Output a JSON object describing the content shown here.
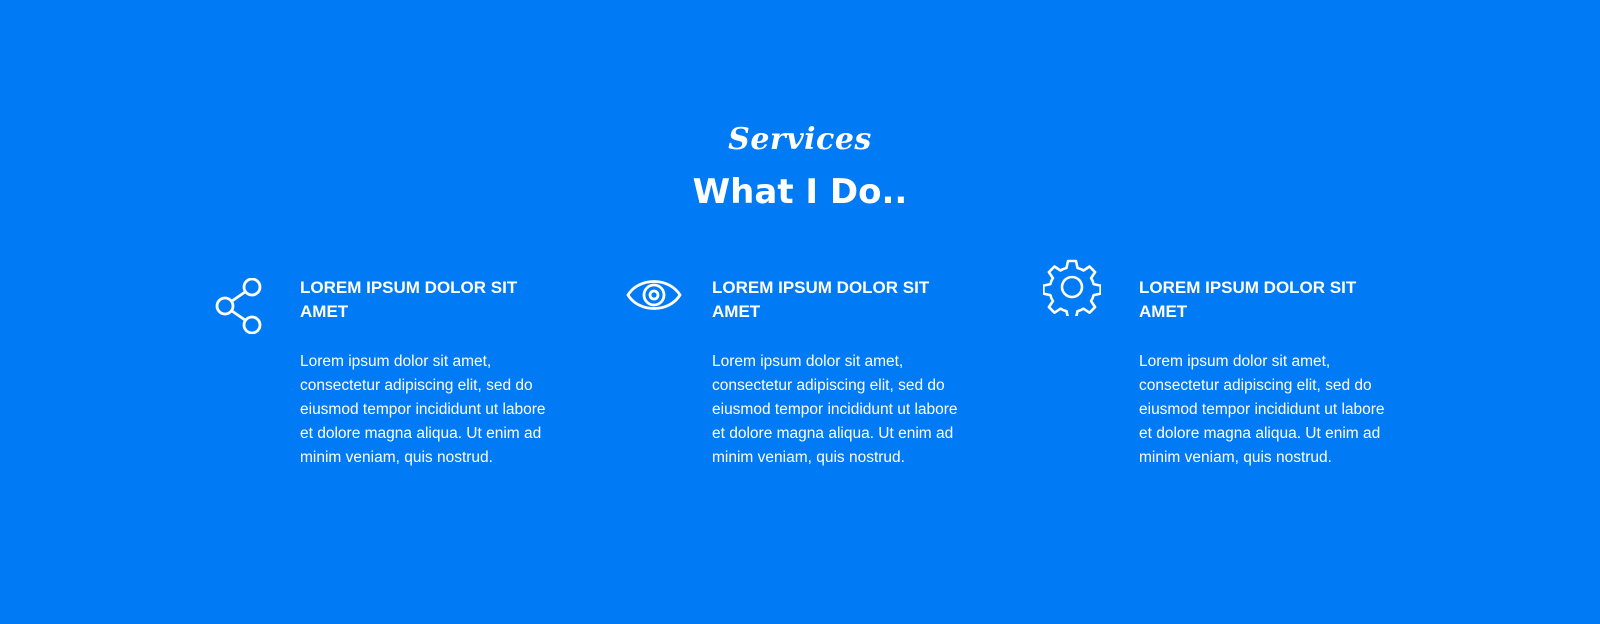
{
  "section": {
    "eyebrow": "Services",
    "title": "What I Do.."
  },
  "services": [
    {
      "icon": "share-icon",
      "title": "LOREM IPSUM DOLOR SIT AMET",
      "text": "Lorem ipsum dolor sit amet, consectetur adipiscing elit, sed do eiusmod tempor incididunt ut labore et dolore magna aliqua. Ut enim ad minim veniam, quis nostrud."
    },
    {
      "icon": "eye-icon",
      "title": "LOREM IPSUM DOLOR SIT AMET",
      "text": "Lorem ipsum dolor sit amet, consectetur adipiscing elit, sed do eiusmod tempor incididunt ut labore et dolore magna aliqua. Ut enim ad minim veniam, quis nostrud."
    },
    {
      "icon": "gear-icon",
      "title": "LOREM IPSUM DOLOR SIT AMET",
      "text": "Lorem ipsum dolor sit amet, consectetur adipiscing elit, sed do eiusmod tempor incididunt ut labore et dolore magna aliqua. Ut enim ad minim veniam, quis nostrud."
    }
  ],
  "colors": {
    "background": "#007bf5",
    "text": "#ffffff"
  }
}
